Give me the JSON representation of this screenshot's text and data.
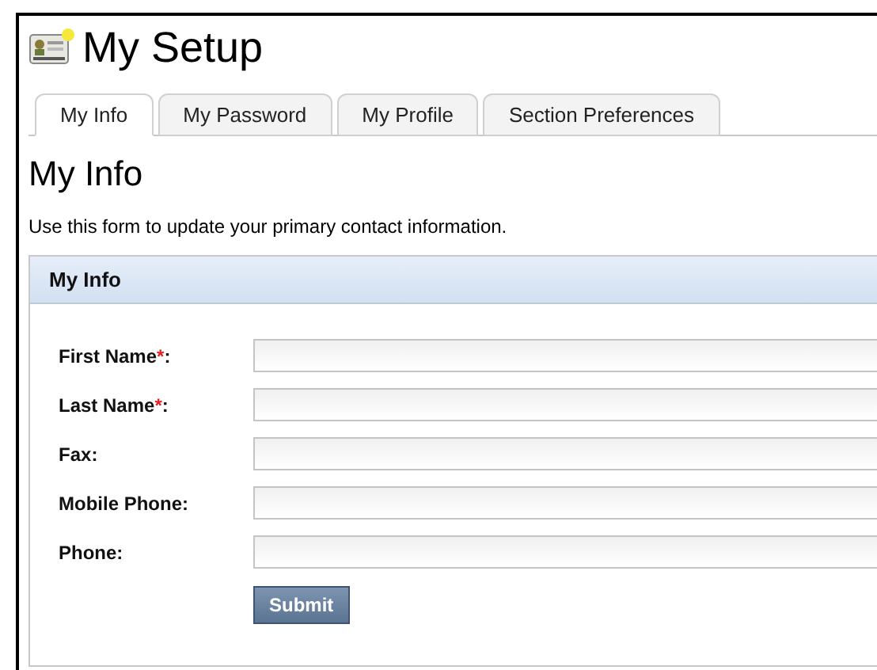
{
  "header": {
    "title": "My Setup"
  },
  "tabs": [
    {
      "label": "My Info",
      "selected": true
    },
    {
      "label": "My Password",
      "selected": false
    },
    {
      "label": "My Profile",
      "selected": false
    },
    {
      "label": "Section Preferences",
      "selected": false
    }
  ],
  "page": {
    "heading": "My Info",
    "description": "Use this form to update your primary contact information."
  },
  "panel": {
    "title": "My Info",
    "fields": [
      {
        "label": "First Name",
        "required_mark": "*",
        "colon": ":"
      },
      {
        "label": "Last Name",
        "required_mark": "*",
        "colon": ":"
      },
      {
        "label": "Fax",
        "colon": ":"
      },
      {
        "label": "Mobile Phone",
        "colon": ":"
      },
      {
        "label": "Phone",
        "colon": ":"
      }
    ],
    "submit": "Submit"
  }
}
